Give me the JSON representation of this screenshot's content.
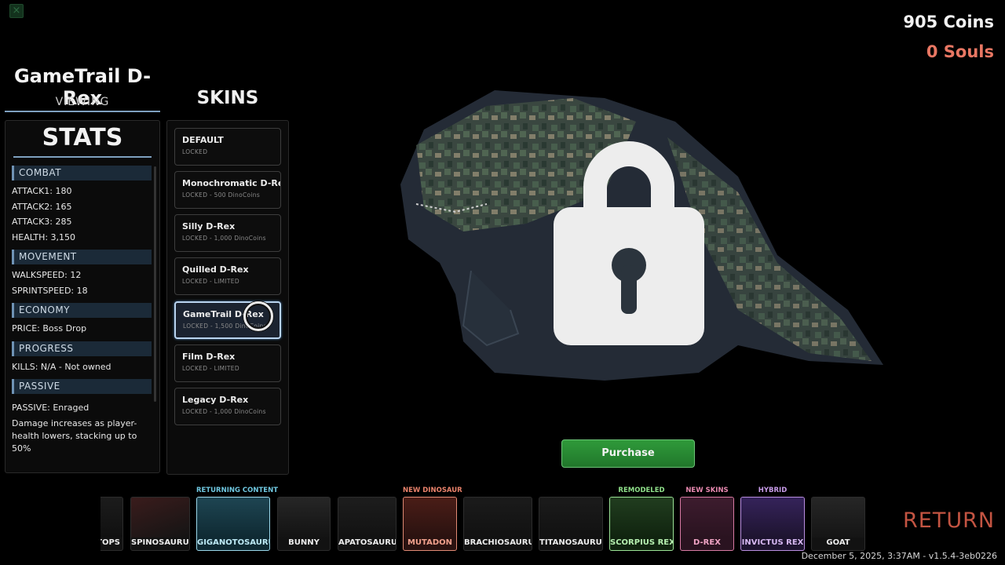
{
  "currency": {
    "coins": "905 Coins",
    "souls": "0 Souls"
  },
  "header": {
    "dino_name": "GameTrail D-Rex",
    "viewing_label": "VIEWING",
    "skins_heading": "SKINS"
  },
  "stats": {
    "title": "STATS",
    "combat": {
      "label": "COMBAT",
      "lines": [
        "ATTACK1: 180",
        "ATTACK2: 165",
        "ATTACK3: 285",
        "HEALTH: 3,150"
      ]
    },
    "movement": {
      "label": "MOVEMENT",
      "lines": [
        "WALKSPEED: 12",
        "SPRINTSPEED: 18"
      ]
    },
    "economy": {
      "label": "ECONOMY",
      "lines": [
        "PRICE: Boss Drop"
      ]
    },
    "progress": {
      "label": "PROGRESS",
      "lines": [
        "KILLS: N/A - Not owned"
      ]
    },
    "passive": {
      "label": "PASSIVE",
      "lines": [
        "PASSIVE: Enraged"
      ],
      "description": "Damage increases as player-health lowers, stacking up to 50%"
    }
  },
  "skins": [
    {
      "name": "DEFAULT",
      "status": "LOCKED"
    },
    {
      "name": "Monochromatic D-Rex",
      "status": "LOCKED - 500 DinoCoins"
    },
    {
      "name": "Silly D-Rex",
      "status": "LOCKED - 1,000 DinoCoins"
    },
    {
      "name": "Quilled D-Rex",
      "status": "LOCKED - LIMITED"
    },
    {
      "name": "GameTrail D-Rex",
      "status": "LOCKED - 1,500 DinoCoins",
      "selected": true
    },
    {
      "name": "Film D-Rex",
      "status": "LOCKED - LIMITED"
    },
    {
      "name": "Legacy D-Rex",
      "status": "LOCKED - 1,000 DinoCoins"
    }
  ],
  "purchase_label": "Purchase",
  "preview": {
    "lock_icon": "padlock-icon",
    "model": "d-rex-model"
  },
  "carousel": [
    {
      "name": "TOPS",
      "tag": ""
    },
    {
      "name": "SPINOSAURUS",
      "tag": ""
    },
    {
      "name": "GIGANOTOSAURUS",
      "tag": "RETURNING CONTENT"
    },
    {
      "name": "BUNNY",
      "tag": ""
    },
    {
      "name": "APATOSAURUS",
      "tag": ""
    },
    {
      "name": "MUTADON",
      "tag": "NEW DINOSAUR"
    },
    {
      "name": "BRACHIOSAURUS",
      "tag": ""
    },
    {
      "name": "TITANOSAURUS",
      "tag": ""
    },
    {
      "name": "SCORPIUS REX",
      "tag": "REMODELED"
    },
    {
      "name": "D-REX",
      "tag": "NEW SKINS"
    },
    {
      "name": "INVICTUS REX",
      "tag": "HYBRID"
    },
    {
      "name": "GOAT",
      "tag": ""
    }
  ],
  "return_label": "RETURN",
  "version_text": "December 5, 2025, 3:37AM - v1.5.4-3eb0226",
  "colors": {
    "accent": "#7ea0bf",
    "souls": "#e97763",
    "purchase": "#2f9a3a",
    "return": "#c35442",
    "tag_returning": "#6fc7e0",
    "tag_new_dino": "#e9826b",
    "tag_remodeled": "#8fe08a",
    "tag_new_skins": "#e889b0",
    "tag_hybrid": "#c79be8"
  }
}
